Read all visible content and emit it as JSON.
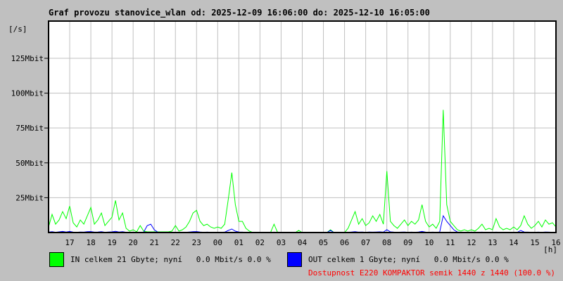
{
  "page": {
    "background": "#c0c0c0"
  },
  "title": "Graf provozu stanovice_wlan od: 2025-12-09 16:06:00 do: 2025-12-10 16:05:00",
  "axes": {
    "y_unit": "[/s]",
    "x_unit": "[h]"
  },
  "legend": {
    "in": {
      "label": "IN celkem 21 Gbyte; nyní   0.0 Mbit/s 0.0 %",
      "color": "#00ff00"
    },
    "out": {
      "label": "OUT celkem 1 Gbyte; nyní   0.0 Mbit/s 0.0 %",
      "color": "#0000ff"
    },
    "availability": {
      "label": "Dostupnost E220 KOMPAKTOR semik 1440 z 1440 (100.0 %)",
      "color": "#ff0000"
    }
  },
  "chart_data": {
    "type": "line",
    "title": "Graf provozu stanovice_wlan od: 2025-12-09 16:06:00 do: 2025-12-10 16:05:00",
    "xlabel": "[h]",
    "ylabel": "[/s]",
    "x_start": "2025-12-09 16:06:00",
    "x_end": "2025-12-10 16:05:00",
    "sample_interval_minutes": 10,
    "grid": true,
    "x_tick_labels": [
      "17",
      "18",
      "19",
      "20",
      "21",
      "22",
      "23",
      "00",
      "01",
      "02",
      "03",
      "04",
      "05",
      "06",
      "07",
      "08",
      "09",
      "10",
      "11",
      "12",
      "13",
      "14",
      "15",
      "16"
    ],
    "y_ticks": [
      {
        "value": 25,
        "label": "25Mbit"
      },
      {
        "value": 50,
        "label": "50Mbit"
      },
      {
        "value": 75,
        "label": "75Mbit"
      },
      {
        "value": 100,
        "label": "100Mbit"
      },
      {
        "value": 125,
        "label": "125Mbit"
      }
    ],
    "ylim": [
      0,
      151.7
    ],
    "colors": {
      "plot_bg": "#ffffff",
      "grid": "#c0c0c0",
      "border": "#000000"
    },
    "series": [
      {
        "name": "IN",
        "unit": "Mbit/s",
        "color": "#00ff00",
        "total": "21 Gbyte",
        "now_mbits": 0.0,
        "now_pct": 0.0,
        "values": [
          4,
          13,
          6,
          9,
          15,
          10,
          19,
          7,
          4,
          9,
          6,
          12,
          18,
          6,
          9,
          14,
          5,
          8,
          11,
          23,
          9,
          14,
          3,
          1,
          2,
          0.5,
          5,
          1,
          0.5,
          0.5,
          0.5,
          0.5,
          0.5,
          0.5,
          0.5,
          1,
          5,
          1,
          2,
          4,
          8,
          14,
          16,
          8,
          5,
          6,
          4,
          3,
          4,
          3,
          6,
          24,
          43,
          20,
          8,
          8,
          3,
          1,
          0,
          0,
          0,
          0,
          0,
          0,
          6,
          0,
          0,
          0,
          0,
          0,
          0,
          1.5,
          0,
          0,
          0,
          0,
          0,
          0,
          0,
          0,
          2,
          0,
          0,
          0,
          0,
          3,
          9,
          15,
          6,
          10,
          5,
          7,
          12,
          8,
          13,
          6,
          44,
          8,
          5,
          3,
          6,
          9,
          5,
          8,
          6,
          9,
          20,
          8,
          4,
          6,
          3,
          8,
          88,
          20,
          8,
          5,
          2,
          1,
          2,
          1,
          2,
          1,
          3,
          6,
          2,
          3,
          2,
          10,
          4,
          2,
          3,
          2,
          4,
          2,
          5,
          12,
          6,
          3,
          5,
          8,
          4,
          9,
          6,
          7,
          4
        ]
      },
      {
        "name": "OUT",
        "unit": "Mbit/s",
        "color": "#0000ff",
        "total": "1 Gbyte",
        "now_mbits": 0.0,
        "now_pct": 0.0,
        "values": [
          0.3,
          0.6,
          0.2,
          0.5,
          0.8,
          0.4,
          0.8,
          0.3,
          0.2,
          0.4,
          0.3,
          0.6,
          0.7,
          0.3,
          0.4,
          0.6,
          0.2,
          0.4,
          0.5,
          0.9,
          0.4,
          0.6,
          0.2,
          0.1,
          0.1,
          0.1,
          0.2,
          0.3,
          5,
          6,
          2,
          0.3,
          0.2,
          0.1,
          0.1,
          0.1,
          0.2,
          0.1,
          0.1,
          0.2,
          0.4,
          0.6,
          0.7,
          0.4,
          0.2,
          0.3,
          0.2,
          0.2,
          0.2,
          0.2,
          0.3,
          1.5,
          2.5,
          1,
          0.4,
          0.3,
          0.1,
          0,
          0,
          0,
          0,
          0,
          0,
          0,
          0.3,
          0,
          0,
          0,
          0,
          0,
          0,
          0.1,
          0,
          0,
          0,
          0,
          0,
          0,
          0,
          0,
          1.5,
          0,
          0,
          0,
          0,
          0.2,
          0.4,
          0.6,
          0.3,
          0.4,
          0.2,
          0.4,
          0.3,
          0.4,
          0.5,
          0.3,
          2,
          0.5,
          0.3,
          0.2,
          0.3,
          0.4,
          0.2,
          0.3,
          0.2,
          0.4,
          0.8,
          0.3,
          0.2,
          0.3,
          0.2,
          0.4,
          12,
          8,
          5,
          2,
          0.4,
          0.2,
          0.2,
          0.1,
          0.2,
          0.1,
          0.2,
          0.3,
          0.1,
          0.2,
          0.1,
          0.3,
          0.2,
          0.1,
          0.2,
          0.1,
          0.2,
          0.1,
          1.5,
          0.4,
          0.3,
          0.2,
          0.2,
          0.3,
          0.2,
          0.4,
          0.3,
          0.2,
          0.2
        ]
      }
    ]
  }
}
